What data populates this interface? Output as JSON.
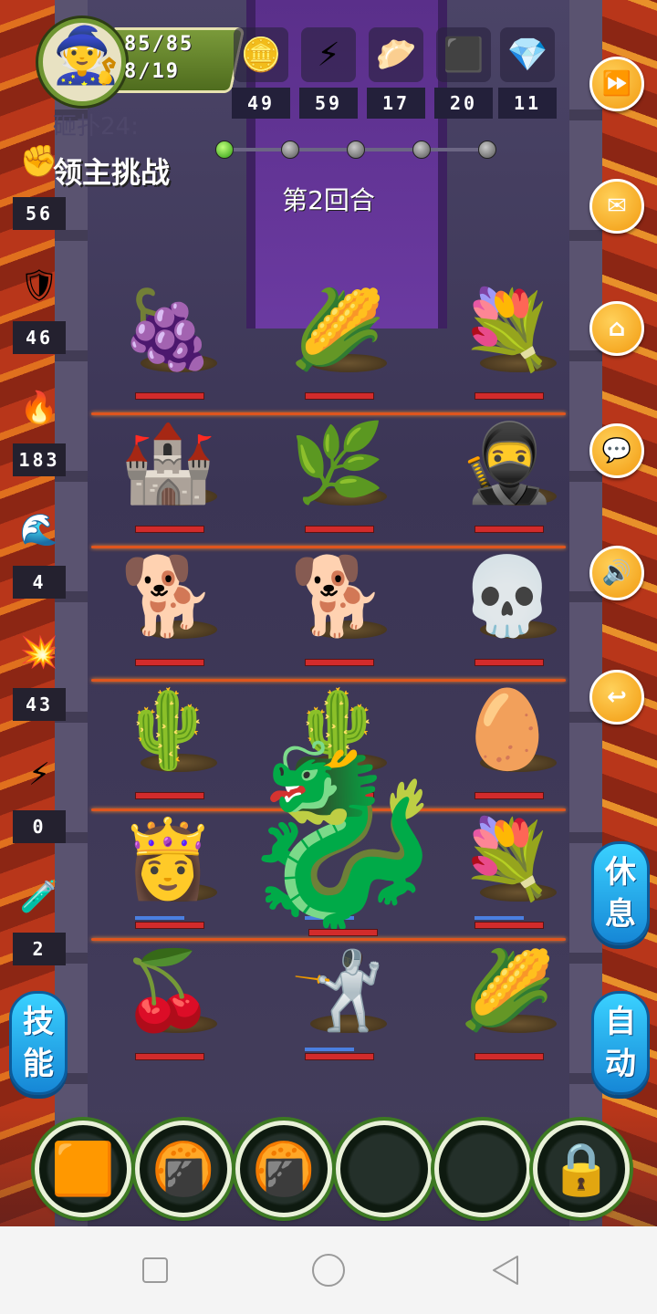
{
  "player": {
    "hp": "85/85",
    "level": "8/19",
    "avatar_icon": "wizard-avatar-icon"
  },
  "resources": [
    {
      "name": "gold-coin-icon",
      "glyph": "🪙",
      "value": "49"
    },
    {
      "name": "energy-bolt-icon",
      "glyph": "⚡",
      "value": "59"
    },
    {
      "name": "dumpling-icon",
      "glyph": "🥟",
      "value": "17"
    },
    {
      "name": "iron-ore-icon",
      "glyph": "⬛",
      "value": "20"
    },
    {
      "name": "crystal-gem-icon",
      "glyph": "💎",
      "value": "11"
    }
  ],
  "stats": [
    {
      "name": "fist-attack-icon",
      "glyph": "✊",
      "value": "56"
    },
    {
      "name": "shield-defense-icon",
      "glyph": "🛡",
      "value": "46"
    },
    {
      "name": "holy-flame-icon",
      "glyph": "🔥",
      "value": "183"
    },
    {
      "name": "water-wave-icon",
      "glyph": "🌊",
      "value": "4"
    },
    {
      "name": "fire-burst-icon",
      "glyph": "💥",
      "value": "43"
    },
    {
      "name": "lightning-rune-icon",
      "glyph": "⚡",
      "value": "0"
    },
    {
      "name": "poison-drop-icon",
      "glyph": "🧪",
      "value": "2"
    }
  ],
  "header": {
    "ghost_text": "砸扑24:",
    "boss_title": "领主挑战",
    "round_label": "第2回合",
    "progress_nodes": 5,
    "progress_active": 1
  },
  "side_buttons": [
    {
      "name": "fast-forward-icon",
      "glyph": "⏩"
    },
    {
      "name": "mail-icon",
      "glyph": "✉"
    },
    {
      "name": "home-icon",
      "glyph": "⌂"
    },
    {
      "name": "chat-icon",
      "glyph": "💬"
    },
    {
      "name": "sound-icon",
      "glyph": "🔊"
    },
    {
      "name": "return-icon",
      "glyph": "↩"
    }
  ],
  "grid": [
    [
      {
        "name": "grape-plant",
        "glyph": "🍇",
        "mp": false
      },
      {
        "name": "corn-plant",
        "glyph": "🌽",
        "mp": false
      },
      {
        "name": "violet-flower",
        "glyph": "💐",
        "mp": false
      }
    ],
    [
      {
        "name": "stone-tower",
        "glyph": "🏰",
        "mp": false
      },
      {
        "name": "green-sprout",
        "glyph": "🌿",
        "mp": false
      },
      {
        "name": "silver-hair-swordsman",
        "glyph": "🥷",
        "mp": false
      }
    ],
    [
      {
        "name": "fluffy-dog",
        "glyph": "🐕",
        "mp": false
      },
      {
        "name": "fluffy-dog",
        "glyph": "🐕",
        "mp": false
      },
      {
        "name": "skeleton-hammer",
        "glyph": "💀",
        "mp": false
      }
    ],
    [
      {
        "name": "thorn-vine",
        "glyph": "🌵",
        "mp": false
      },
      {
        "name": "thorn-vine",
        "glyph": "🌵",
        "mp": false
      },
      {
        "name": "blue-egg",
        "glyph": "🥚",
        "mp": false
      }
    ],
    [
      {
        "name": "crowned-princess",
        "glyph": "👸",
        "mp": true
      },
      {
        "name": "dragon-slot",
        "glyph": "",
        "mp": true
      },
      {
        "name": "violet-flower",
        "glyph": "💐",
        "mp": true
      }
    ],
    [
      {
        "name": "red-berry-bush",
        "glyph": "🍒",
        "mp": false
      },
      {
        "name": "blonde-swordsman",
        "glyph": "🤺",
        "mp": true
      },
      {
        "name": "corn-plant",
        "glyph": "🌽",
        "mp": false
      }
    ]
  ],
  "dragon": {
    "name": "brown-dragon-boss",
    "glyph": "🐉"
  },
  "left_button": {
    "label_1": "技",
    "label_2": "能"
  },
  "rest_button": {
    "label_1": "休",
    "label_2": "息"
  },
  "auto_button": {
    "label_1": "自",
    "label_2": "动"
  },
  "slots": [
    {
      "name": "gold-bar-icon",
      "glyph": "🟧"
    },
    {
      "name": "cracker-biscuit-icon",
      "glyph": "🍘"
    },
    {
      "name": "cracker-biscuit-icon",
      "glyph": "🍘"
    },
    {
      "name": "empty-slot",
      "glyph": ""
    },
    {
      "name": "empty-slot",
      "glyph": ""
    },
    {
      "name": "padlock-icon",
      "glyph": "🔒"
    }
  ],
  "navbar": {
    "recent": "□",
    "home": "○",
    "back": "◁"
  }
}
